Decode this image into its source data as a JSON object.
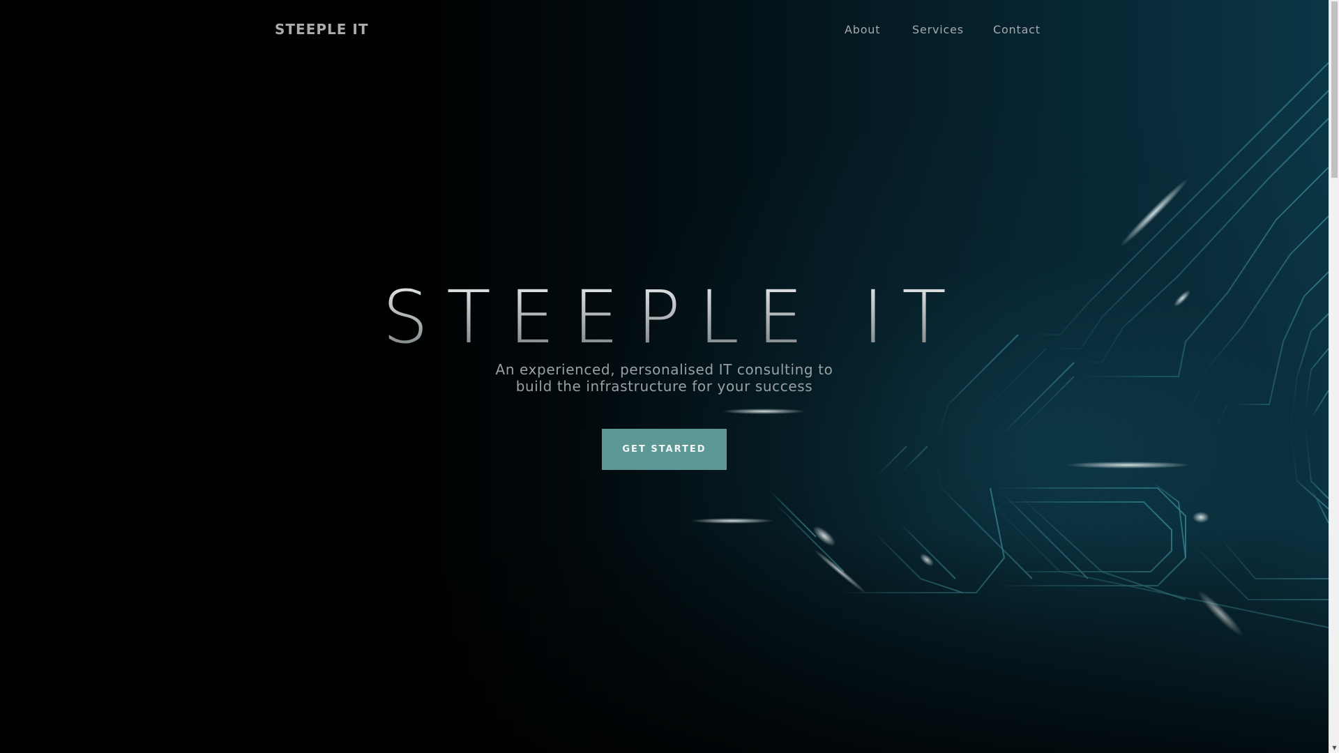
{
  "nav": {
    "brand": "STEEPLE IT",
    "links": [
      {
        "label": "About"
      },
      {
        "label": "Services"
      },
      {
        "label": "Contact"
      }
    ]
  },
  "hero": {
    "title": "STEEPLE IT",
    "subtitle_line1": "An experienced, personalised IT consulting to",
    "subtitle_line2": "build the infrastructure for your success",
    "cta_label": "GET STARTED"
  },
  "colors": {
    "accent": "#5e9896",
    "background": "#000000",
    "circuit": "#1f5a66"
  },
  "icons": {
    "scroll_down": "chevron-down-icon"
  }
}
